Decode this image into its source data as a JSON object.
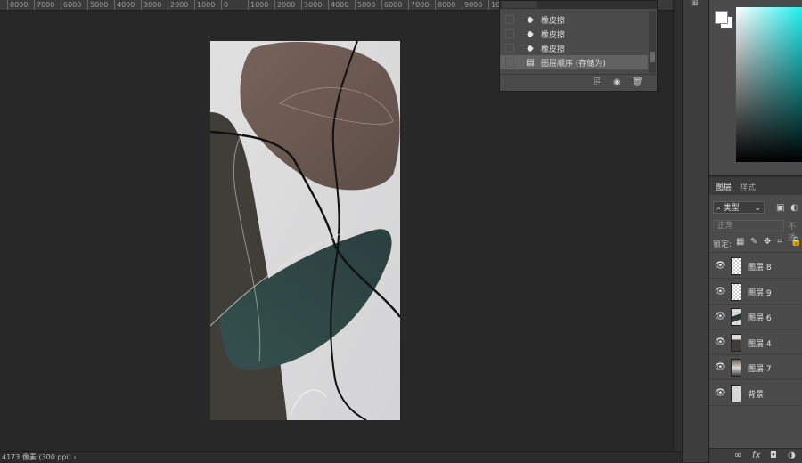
{
  "ruler": {
    "ticks": [
      "8000",
      "7000",
      "6000",
      "5000",
      "4000",
      "3000",
      "2000",
      "1000",
      "0",
      "1000",
      "2000",
      "3000",
      "4000",
      "5000",
      "6000",
      "7000",
      "8000",
      "9000",
      "10000"
    ]
  },
  "status_bar": {
    "text": "4173 像素 (300 ppi)",
    "arrow": "›"
  },
  "history_panel": {
    "rows": [
      {
        "label": "橡皮擦",
        "icon": "eraser-icon",
        "glyph": "◆",
        "selected": false
      },
      {
        "label": "橡皮擦",
        "icon": "eraser-icon",
        "glyph": "◆",
        "selected": false
      },
      {
        "label": "橡皮擦",
        "icon": "eraser-icon",
        "glyph": "◆",
        "selected": false
      },
      {
        "label": "图层顺序 (存储为)",
        "icon": "document-icon",
        "glyph": "▤",
        "selected": true
      }
    ],
    "footer": {
      "new_doc_glyph": "⎘",
      "snapshot_glyph": "◉",
      "delete_glyph": "🗑"
    }
  },
  "toolstrip": {
    "glyph": "⊞"
  },
  "layers_panel": {
    "tabs": [
      {
        "label": "图层",
        "active": true
      },
      {
        "label": "样式",
        "active": false
      }
    ],
    "kind_filter": {
      "search_glyph": "⌕",
      "label": "类型",
      "arrow": "⌄"
    },
    "filter_icons": [
      "▣",
      "◐"
    ],
    "blend_mode": "正常",
    "opacity_label": "不透",
    "lock_label": "锁定:",
    "lock_icons": [
      "▦",
      "✎",
      "✥",
      "⌗",
      "🔒"
    ],
    "layers": [
      {
        "name": "图层 8",
        "thumb": "t-trans",
        "eye": "👁"
      },
      {
        "name": "图层 9",
        "thumb": "t-trans",
        "eye": "👁"
      },
      {
        "name": "图层 6",
        "thumb": "t-dark",
        "eye": "👁"
      },
      {
        "name": "图层 4",
        "thumb": "t-brown",
        "eye": "👁"
      },
      {
        "name": "图层 7",
        "thumb": "t-mixed",
        "eye": "👁"
      },
      {
        "name": "背景",
        "thumb": "t-bg",
        "eye": "👁"
      }
    ],
    "footer": {
      "link": "∞",
      "fx": "fx",
      "mask": "◘",
      "adjust": "◑"
    }
  },
  "colors": {
    "canvas_bg": "#282828",
    "panel_bg": "#4b4b4b",
    "paper": "#dcdcdc",
    "shape_brown": "#6d5a52",
    "shape_teal": "#2e4442",
    "shape_charcoal": "#3d3c38",
    "picker_hue": "#20f0f0"
  }
}
